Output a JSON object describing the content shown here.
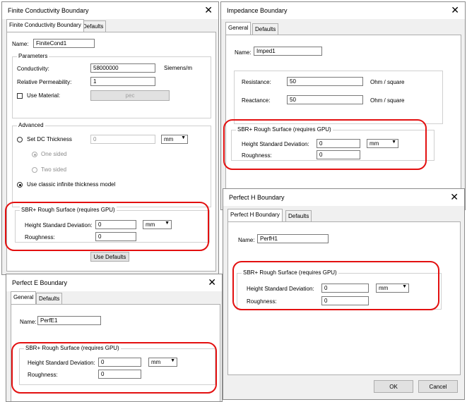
{
  "fc": {
    "title": "Finite Conductivity Boundary",
    "tabs": [
      "Finite Conductivity Boundary",
      "Defaults"
    ],
    "name_label": "Name:",
    "name_value": "FiniteCond1",
    "parameters_label": "Parameters",
    "conductivity_label": "Conductivity:",
    "conductivity_value": "58000000",
    "conductivity_unit": "Siemens/m",
    "permeability_label": "Relative Permeability:",
    "permeability_value": "1",
    "use_material_label": "Use Material:",
    "material_button": "pec",
    "advanced_label": "Advanced",
    "dc_thickness_label": "Set DC Thickness",
    "dc_thickness_value": "0",
    "dc_thickness_unit": "mm",
    "one_sided_label": "One sided",
    "two_sided_label": "Two sided",
    "classic_label": "Use classic infinite thickness model",
    "sbr_label": "SBR+ Rough Surface (requires GPU)",
    "height_label": "Height Standard Deviation:",
    "height_value": "0",
    "height_unit": "mm",
    "roughness_label": "Roughness:",
    "roughness_value": "0",
    "use_defaults_button": "Use Defaults"
  },
  "imp": {
    "title": "Impedance Boundary",
    "tabs": [
      "General",
      "Defaults"
    ],
    "name_label": "Name:",
    "name_value": "Imped1",
    "resistance_label": "Resistance:",
    "resistance_value": "50",
    "resistance_unit": "Ohm / square",
    "reactance_label": "Reactance:",
    "reactance_value": "50",
    "reactance_unit": "Ohm / square",
    "sbr_label": "SBR+ Rough Surface (requires GPU)",
    "height_label": "Height Standard Deviation:",
    "height_value": "0",
    "height_unit": "mm",
    "roughness_label": "Roughness:",
    "roughness_value": "0"
  },
  "ph": {
    "title": "Perfect H Boundary",
    "tabs": [
      "Perfect H Boundary",
      "Defaults"
    ],
    "name_label": "Name:",
    "name_value": "PerfH1",
    "sbr_label": "SBR+ Rough Surface (requires GPU)",
    "height_label": "Height Standard Deviation:",
    "height_value": "0",
    "height_unit": "mm",
    "roughness_label": "Roughness:",
    "roughness_value": "0",
    "ok_button": "OK",
    "cancel_button": "Cancel"
  },
  "pe": {
    "title": "Perfect E Boundary",
    "tabs": [
      "General",
      "Defaults"
    ],
    "name_label": "Name:",
    "name_value": "PerfE1",
    "sbr_label": "SBR+ Rough Surface (requires GPU)",
    "height_label": "Height Standard Deviation:",
    "height_value": "0",
    "height_unit": "mm",
    "roughness_label": "Roughness:",
    "roughness_value": "0"
  },
  "close_glyph": "✕",
  "dropdown_glyph": "▼",
  "highlight_color": "#e31010"
}
